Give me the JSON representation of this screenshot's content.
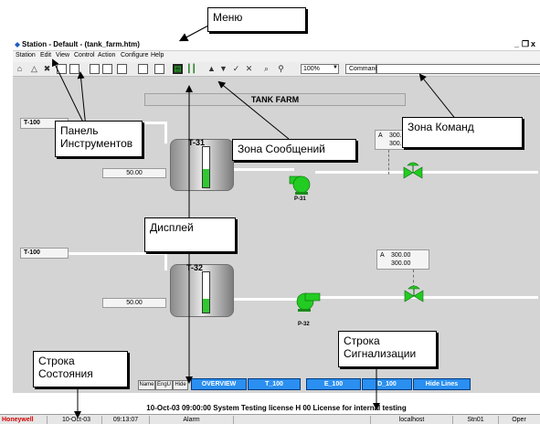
{
  "window": {
    "title": "Station - Default - (tank_farm.htm)",
    "controls": [
      "_",
      "❐",
      "x"
    ]
  },
  "menu": [
    "Station",
    "Edit",
    "View",
    "Control",
    "Action",
    "Configure",
    "Help"
  ],
  "toolbar": {
    "zoom": "100%",
    "command_label": "Command"
  },
  "display": {
    "banner": "TANK FARM",
    "line1": {
      "tag": "T-100",
      "tank": "T-31",
      "value": "50.00",
      "pump": "P-31",
      "alarm_flag": "A",
      "alarm_v1": "300.00",
      "alarm_v2": "300.00",
      "level": 0.45
    },
    "line2": {
      "tag": "T-100",
      "tank": "T-32",
      "value": "50.00",
      "pump": "P-32",
      "alarm_flag": "A",
      "alarm_v1": "300.00",
      "alarm_v2": "300.00",
      "level": 0.35
    }
  },
  "small_buttons": [
    "Name",
    "EngU",
    "Hide"
  ],
  "nav_buttons": [
    "OVERVIEW",
    "T_100",
    "E_100",
    "D_100",
    "Hide Lines"
  ],
  "message_line": "10-Oct-03 09:00:00 System Testing license H 00 License for internal testing",
  "status_bar": {
    "brand": "Honeywell",
    "date": "10-Oct-03",
    "time": "09:13:07",
    "alarm": "Alarm",
    "host": "localhost",
    "station": "Stn01",
    "mode": "Oper"
  },
  "callouts": {
    "menu": "Меню",
    "toolbar": "Панель Инструментов",
    "messages": "Зона Сообщений",
    "commands": "Зона Команд",
    "display": "Дисплей",
    "alarm_line": "Строка Сигнализации",
    "status_line": "Строка Состояния"
  },
  "colors": {
    "nav_button": "#2a8ff0",
    "pump": "#22cc22",
    "level_fill": "#32c832",
    "brand": "#d40000",
    "display_bg": "#d4d4d4"
  },
  "icons": [
    "station-icon",
    "alarm-triangle-icon",
    "acknowledge-icon",
    "page-back-icon",
    "page-forward-icon",
    "trend-icon",
    "save-icon",
    "print-icon",
    "faceplate-icon",
    "up-arrow-icon",
    "down-arrow-icon",
    "check-icon",
    "cancel-icon",
    "zoom-icon"
  ]
}
